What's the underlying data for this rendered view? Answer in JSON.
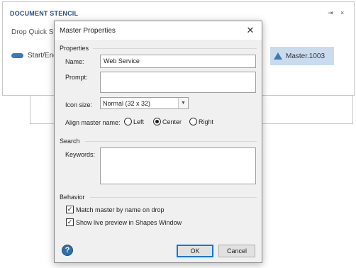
{
  "stencil": {
    "title": "DOCUMENT STENCIL",
    "pin_icon": "⇥",
    "close_icon": "×",
    "hint": "Drop Quick Sh",
    "shapes": [
      {
        "label": "Start/End",
        "icon": "pill-shape-icon"
      },
      {
        "label": "Master.1003",
        "icon": "triangle-shape-icon"
      }
    ],
    "selected_color": "#c9dcef",
    "shape_color": "#3f78b8"
  },
  "dialog": {
    "title": "Master Properties",
    "close_glyph": "✕",
    "properties_group": "Properties",
    "name_label": "Name:",
    "name_value": "Web Service",
    "prompt_label": "Prompt:",
    "prompt_value": "",
    "icon_size_label": "Icon size:",
    "icon_size_value": "Normal (32 x 32)",
    "align_label": "Align master name:",
    "align_options": [
      {
        "label": "Left",
        "checked": false
      },
      {
        "label": "Center",
        "checked": true
      },
      {
        "label": "Right",
        "checked": false
      }
    ],
    "search_group": "Search",
    "keywords_label": "Keywords:",
    "keywords_value": "",
    "behavior_group": "Behavior",
    "checkboxes": [
      {
        "label": "Match master by name on drop",
        "checked": true
      },
      {
        "label": "Show live preview in Shapes Window",
        "checked": true
      }
    ],
    "help_glyph": "?",
    "ok_label": "OK",
    "cancel_label": "Cancel"
  }
}
